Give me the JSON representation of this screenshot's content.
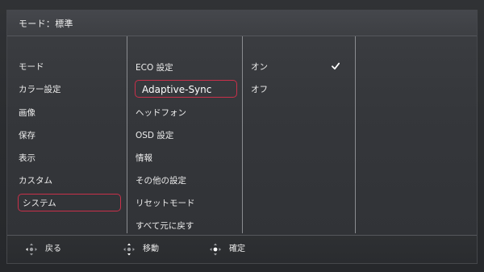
{
  "header": {
    "title": "モード：標準"
  },
  "menu_main": [
    {
      "label": "モード"
    },
    {
      "label": "カラー設定"
    },
    {
      "label": "画像"
    },
    {
      "label": "保存"
    },
    {
      "label": "表示"
    },
    {
      "label": "カスタム"
    },
    {
      "label": "システム",
      "selected": true
    }
  ],
  "menu_system": [
    {
      "label": "ECO 設定"
    },
    {
      "label": "Adaptive-Sync",
      "selected": true
    },
    {
      "label": "ヘッドフォン"
    },
    {
      "label": "OSD 設定"
    },
    {
      "label": "情報"
    },
    {
      "label": "その他の設定"
    },
    {
      "label": "リセットモード"
    },
    {
      "label": "すべて元に戻す"
    }
  ],
  "menu_options": [
    {
      "label": "オン",
      "checked": true
    },
    {
      "label": "オフ"
    }
  ],
  "footer": {
    "back_label": "戻る",
    "move_label": "移動",
    "confirm_label": "確定"
  },
  "colors": {
    "highlight_border": "#c9304a",
    "check": "#ffffff"
  },
  "icons": [
    "dpad-back-icon",
    "dpad-move-icon",
    "dpad-confirm-icon",
    "checkmark-icon"
  ]
}
